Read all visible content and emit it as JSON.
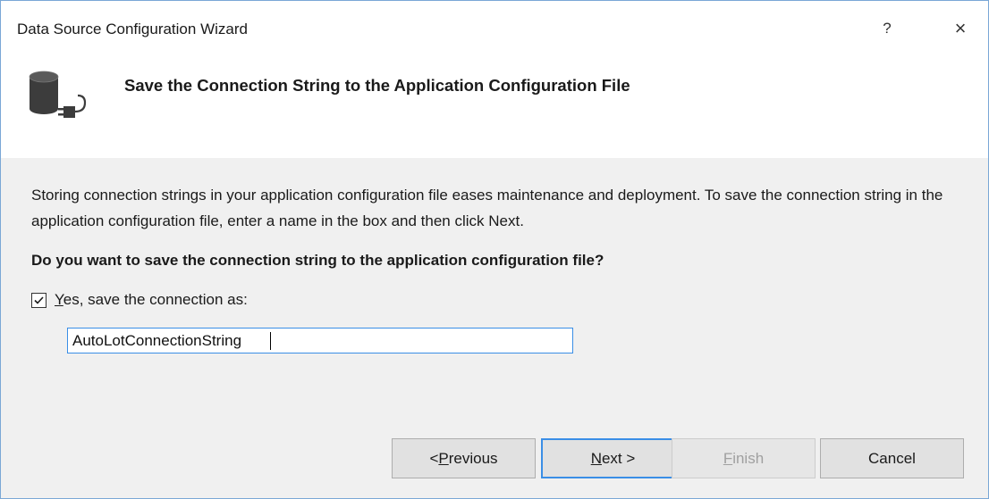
{
  "window": {
    "title": "Data Source Configuration Wizard",
    "help_glyph": "?",
    "close_glyph": "×"
  },
  "header": {
    "icon": "database-connection-icon",
    "title": "Save the Connection String to the Application Configuration File"
  },
  "body": {
    "description": "Storing connection strings in your application configuration file eases maintenance and deployment. To save the connection string in the application configuration file, enter a name in the box and then click Next.",
    "question": "Do you want to save the connection string to the application configuration file?",
    "checkbox": {
      "checked": true,
      "label_mnemonic": "Y",
      "label_rest": "es, save the connection as:"
    },
    "connection_name": "AutoLotConnectionString"
  },
  "buttons": {
    "previous": {
      "prefix": "< ",
      "mnemonic": "P",
      "rest": "revious"
    },
    "next": {
      "mnemonic": "N",
      "rest": "ext >"
    },
    "finish": {
      "mnemonic": "F",
      "rest": "inish",
      "enabled": false
    },
    "cancel": "Cancel"
  },
  "colors": {
    "accent": "#3a8ee6",
    "window_border": "#7aa7d6",
    "dialog_bg": "#f0f0f0",
    "disabled_text": "#a0a0a0"
  }
}
